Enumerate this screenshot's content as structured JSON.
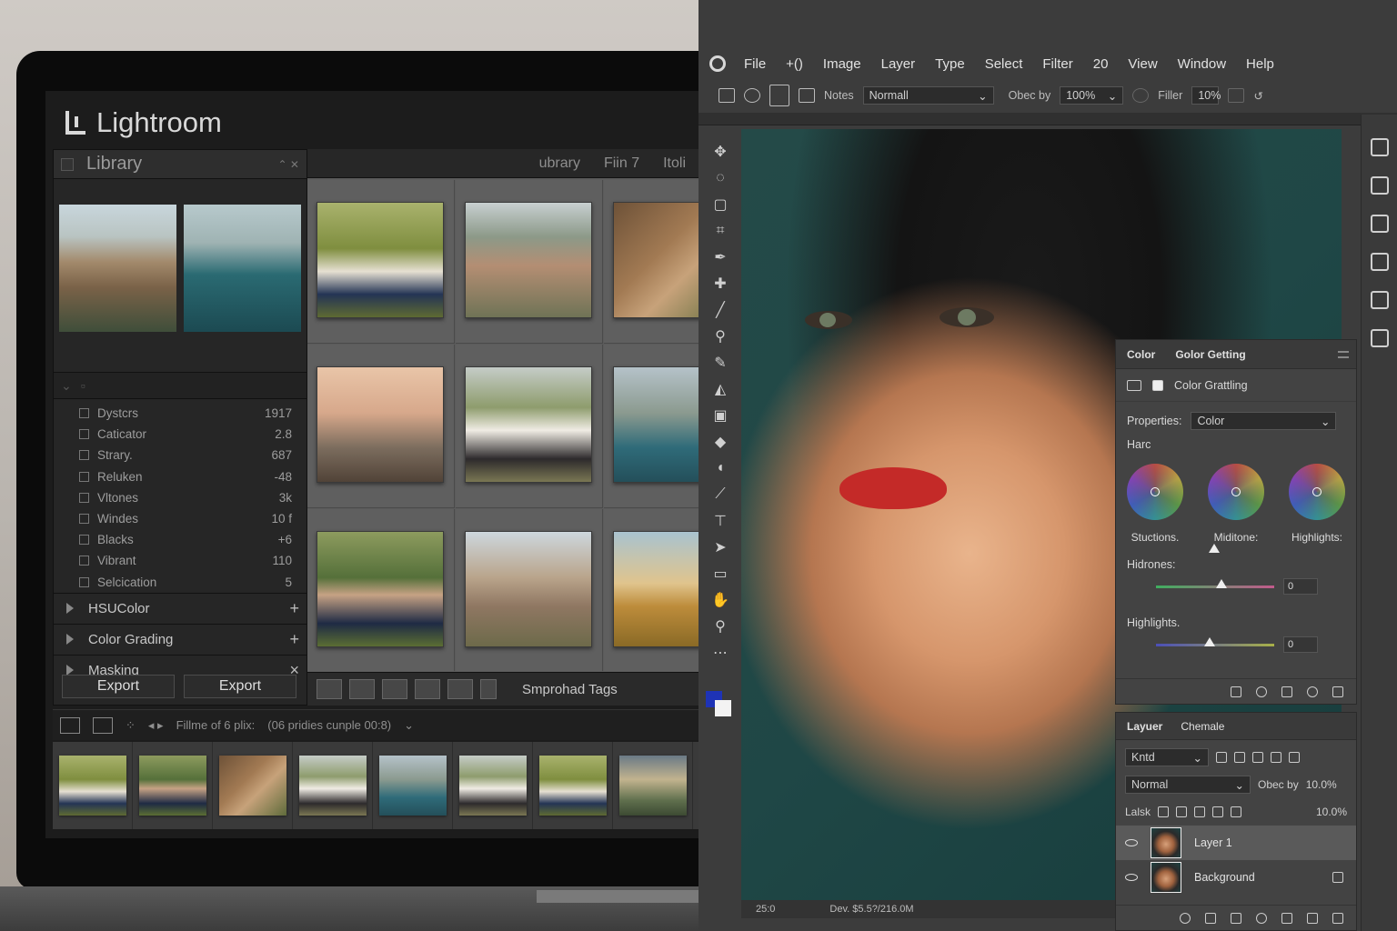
{
  "lightroom": {
    "app_title": "Lightroom",
    "library_label": "Library",
    "grid_tabs": [
      "ubrary",
      "Fiin 7",
      "Itoli"
    ],
    "sliders": [
      {
        "label": "Dystcrs",
        "value": "1917"
      },
      {
        "label": "Caticator",
        "value": "2.8"
      },
      {
        "label": "Strary.",
        "value": "687"
      },
      {
        "label": "Reluken",
        "value": "-48"
      },
      {
        "label": "Vltones",
        "value": "3k"
      },
      {
        "label": "Windes",
        "value": "10 f"
      },
      {
        "label": "Blacks",
        "value": "+6"
      },
      {
        "label": "Vibrant",
        "value": "110"
      },
      {
        "label": "Selcication",
        "value": "5"
      }
    ],
    "accordions": [
      {
        "label": "HSUColor",
        "action": "+"
      },
      {
        "label": "Color Grading",
        "action": "+"
      },
      {
        "label": "Masking",
        "action": "×"
      }
    ],
    "export_buttons": [
      "Export",
      "Export"
    ],
    "toolbar_label": "Smprohad Tags",
    "filmstrip_info": "Fillme of 6 plix:",
    "filmstrip_source": "(06 pridies cunple 00:8)",
    "filmstrip_dropdown_icon": "chevron-down-icon"
  },
  "photoshop": {
    "menu": [
      "File",
      "+()",
      "Image",
      "Layer",
      "Type",
      "Select",
      "Filter",
      "20",
      "View",
      "Window",
      "Help"
    ],
    "options": {
      "notes_label": "Notes",
      "blend_mode": "Normall",
      "opacity_label": "Obec by",
      "opacity_value": "100%",
      "filler_label": "Filler",
      "filler_value": "10%"
    },
    "status": {
      "zoom": "25:0",
      "doc": "Dev. $5.5?/216.0M"
    },
    "color_grading": {
      "tabs": [
        "Color",
        "Golor Getting"
      ],
      "header": "Color Grattling",
      "properties_label": "Properties:",
      "properties_value": "Color",
      "section_label": "Harc",
      "wheels": [
        "Stuctions.",
        "Miditone:",
        "Highlights:"
      ],
      "sliders": [
        {
          "label": "Hidrones:",
          "value": "0",
          "position": 0.55
        },
        {
          "label": "Highlights.",
          "value": "0",
          "position": 0.45
        }
      ]
    },
    "layers": {
      "tabs": [
        "Layuer",
        "Chemale"
      ],
      "filter_value": "Kntd",
      "blend_mode": "Normal",
      "opacity_label": "Obec by",
      "opacity_value": "10.0%",
      "lock_label": "Lalsk",
      "fill_value": "10.0%",
      "items": [
        {
          "name": "Layer 1",
          "selected": true
        },
        {
          "name": "Background",
          "selected": false
        }
      ]
    }
  }
}
